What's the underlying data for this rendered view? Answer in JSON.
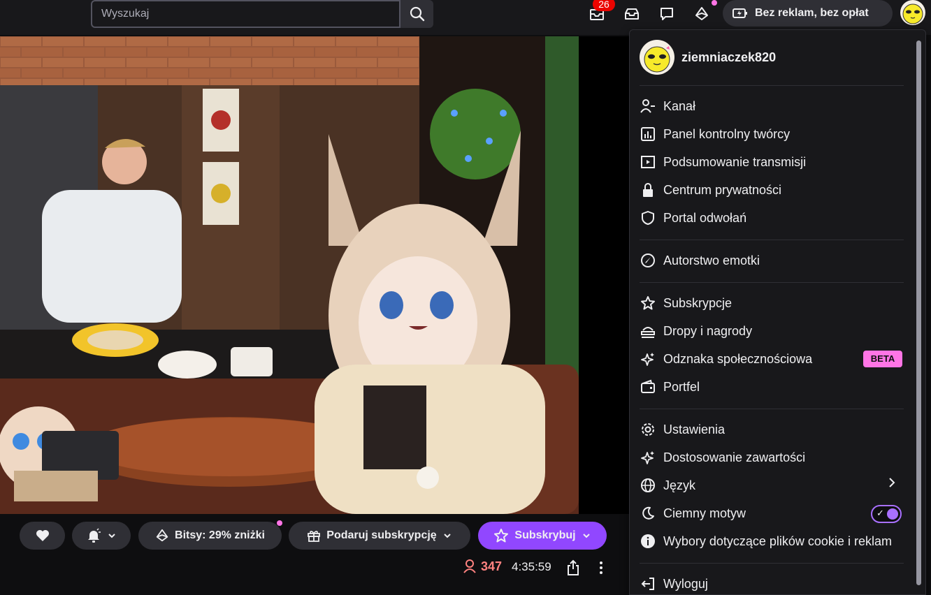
{
  "search": {
    "placeholder": "Wyszukaj"
  },
  "topbar": {
    "notifications_count": "26",
    "noads_label": "Bez reklam, bez opłat"
  },
  "user": {
    "name": "ziemniaczek820"
  },
  "menu": {
    "items_group1": [
      "Kanał",
      "Panel kontrolny twórcy",
      "Podsumowanie transmisji",
      "Centrum prywatności",
      "Portal odwołań"
    ],
    "items_group2": [
      "Autorstwo emotki"
    ],
    "items_group3": [
      "Subskrypcje",
      "Dropy i nagrody",
      "Odznaka społecznościowa",
      "Portfel"
    ],
    "items_group4": [
      "Ustawienia",
      "Dostosowanie zawartości",
      "Język",
      "Ciemny motyw",
      "Wybory dotyczące plików cookie i reklam"
    ],
    "items_group5": [
      "Wyloguj"
    ],
    "beta_label": "BETA",
    "dark_mode_on": true
  },
  "actions": {
    "bits_label": "Bitsy: 29% zniżki",
    "gift_label": "Podaruj subskrypcję",
    "subscribe_label": "Subskrybuj"
  },
  "stream": {
    "viewers": "347",
    "uptime": "4:35:59"
  },
  "colors": {
    "accent": "#9147ff",
    "beta": "#ff75e6",
    "live_red": "#eb0400",
    "viewer_red": "#ff8280"
  }
}
